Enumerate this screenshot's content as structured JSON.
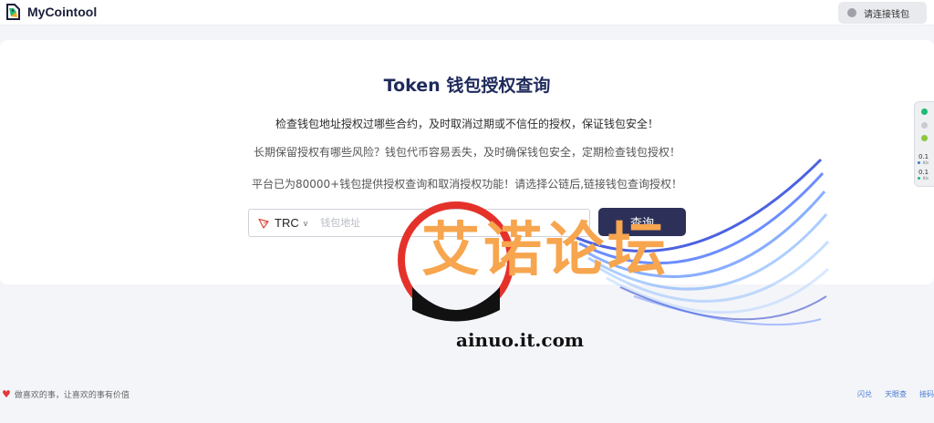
{
  "header": {
    "app_name": "MyCointool",
    "connect_wallet_label": "请连接钱包"
  },
  "main": {
    "title": "Token 钱包授权查询",
    "line1": "检查钱包地址授权过哪些合约，及时取消过期或不信任的授权，保证钱包安全！",
    "line2": "长期保留授权有哪些风险？钱包代币容易丢失，及时确保钱包安全，定期检查钱包授权！",
    "line3": "平台已为80000+钱包提供授权查询和取消授权功能！请选择公链后,链接钱包查询授权！",
    "chain_selected": "TRC",
    "chain_chevron": "v",
    "address_placeholder": "钱包地址",
    "query_label": "查询"
  },
  "side_widget": {
    "value1": "0.1",
    "unit1": "K/s",
    "value2": "0.1",
    "unit2": "K/s"
  },
  "watermark": {
    "text": "艾诺论坛",
    "url": "ainuo.it.com"
  },
  "footer": {
    "motto": "做喜欢的事，让喜欢的事有价值",
    "links": [
      "闪兑",
      "天眼查",
      "接码"
    ]
  },
  "colors": {
    "accent": "#2d3159",
    "title": "#1f2a5c",
    "watermark": "#f7a54e",
    "link": "#4a7bd0"
  },
  "icons": [
    "logo-icon",
    "tron-icon",
    "chevron-down-icon",
    "heart-icon",
    "status-dot-icon"
  ]
}
